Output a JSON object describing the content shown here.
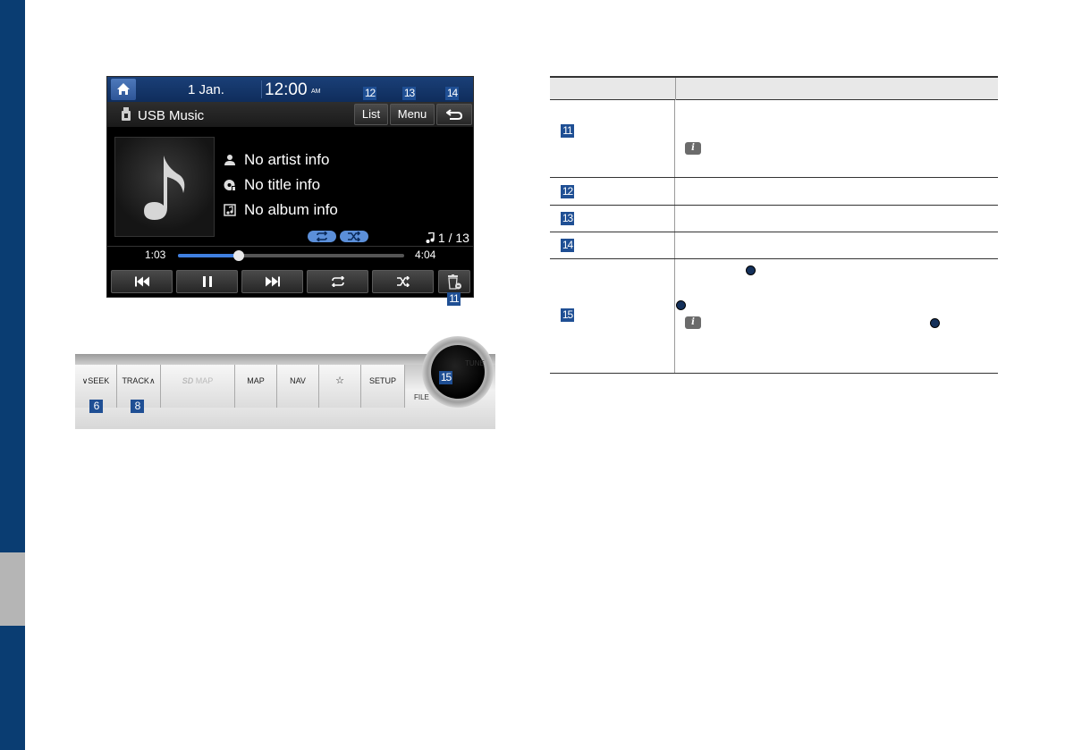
{
  "screen": {
    "date": "1  Jan.",
    "time": "12:00",
    "ampm": "AM",
    "source_title": "USB Music",
    "list_label": "List",
    "menu_label": "Menu",
    "artist": "No artist info",
    "title": "No title info",
    "album": "No album info",
    "track_count": "1 / 13",
    "current_time": "1:03",
    "total_time": "4:04",
    "progress_fraction": 0.27
  },
  "callouts": {
    "c11": "11",
    "c12": "12",
    "c13": "13",
    "c14": "14",
    "c15": "15",
    "c6": "6",
    "c8": "8"
  },
  "panel": {
    "seek": "SEEK",
    "track": "TRACK",
    "sd_map": "MAP",
    "map": "MAP",
    "nav": "NAV",
    "fav": "☆",
    "setup": "SETUP",
    "tune": "TUNE",
    "file": "FILE"
  },
  "table": {
    "rows": [
      "11",
      "12",
      "13",
      "14",
      "15"
    ]
  },
  "colors": {
    "brand_blue": "#1f4f94",
    "side_strip": "#0a3d72",
    "progress": "#3f7fe0"
  }
}
